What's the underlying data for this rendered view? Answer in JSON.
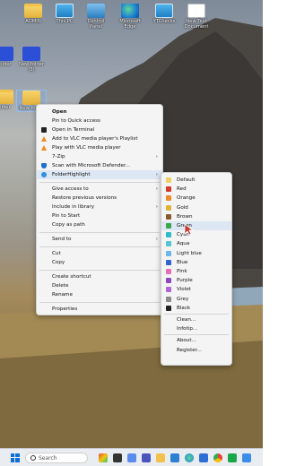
{
  "desktop": {
    "icons": [
      {
        "label": "ADMIN"
      },
      {
        "label": "This PC"
      },
      {
        "label": "Control Panel"
      },
      {
        "label": "Microsoft Edge"
      },
      {
        "label": "YTChecks"
      },
      {
        "label": "New Text Document"
      },
      {
        "label": "folder"
      },
      {
        "label": "New folder (3)"
      },
      {
        "label": "older"
      },
      {
        "label": "New fo (4)"
      }
    ]
  },
  "context_menu": {
    "items": [
      {
        "label": "Open"
      },
      {
        "label": "Pin to Quick access"
      },
      {
        "label": "Open in Terminal"
      },
      {
        "label": "Add to VLC media player's Playlist"
      },
      {
        "label": "Play with VLC media player"
      },
      {
        "label": "7-Zip"
      },
      {
        "label": "Scan with Microsoft Defender..."
      },
      {
        "label": "FolderHighlight"
      },
      {
        "label": "Give access to"
      },
      {
        "label": "Restore previous versions"
      },
      {
        "label": "Include in library"
      },
      {
        "label": "Pin to Start"
      },
      {
        "label": "Copy as path"
      },
      {
        "label": "Send to"
      },
      {
        "label": "Cut"
      },
      {
        "label": "Copy"
      },
      {
        "label": "Create shortcut"
      },
      {
        "label": "Delete"
      },
      {
        "label": "Rename"
      },
      {
        "label": "Properties"
      }
    ]
  },
  "submenu": {
    "items": [
      {
        "label": "Default",
        "color": "#f2cf63"
      },
      {
        "label": "Red",
        "color": "#d33a2c"
      },
      {
        "label": "Orange",
        "color": "#ee8b2a"
      },
      {
        "label": "Gold",
        "color": "#e0b43a"
      },
      {
        "label": "Brown",
        "color": "#8a5a2f"
      },
      {
        "label": "Green",
        "color": "#3aa64a"
      },
      {
        "label": "Cyan",
        "color": "#2fbcc9"
      },
      {
        "label": "Aqua",
        "color": "#56c4d8"
      },
      {
        "label": "Light blue",
        "color": "#6fb6ea"
      },
      {
        "label": "Blue",
        "color": "#2f63d6"
      },
      {
        "label": "Pink",
        "color": "#e66fb4"
      },
      {
        "label": "Purple",
        "color": "#8e46c2"
      },
      {
        "label": "Violet",
        "color": "#b066d6"
      },
      {
        "label": "Grey",
        "color": "#8c8c8c"
      },
      {
        "label": "Black",
        "color": "#222222"
      },
      {
        "label": "Clean..."
      },
      {
        "label": "Infotip..."
      },
      {
        "label": "About..."
      },
      {
        "label": "Register..."
      }
    ]
  },
  "taskbar": {
    "search_label": "Search"
  }
}
